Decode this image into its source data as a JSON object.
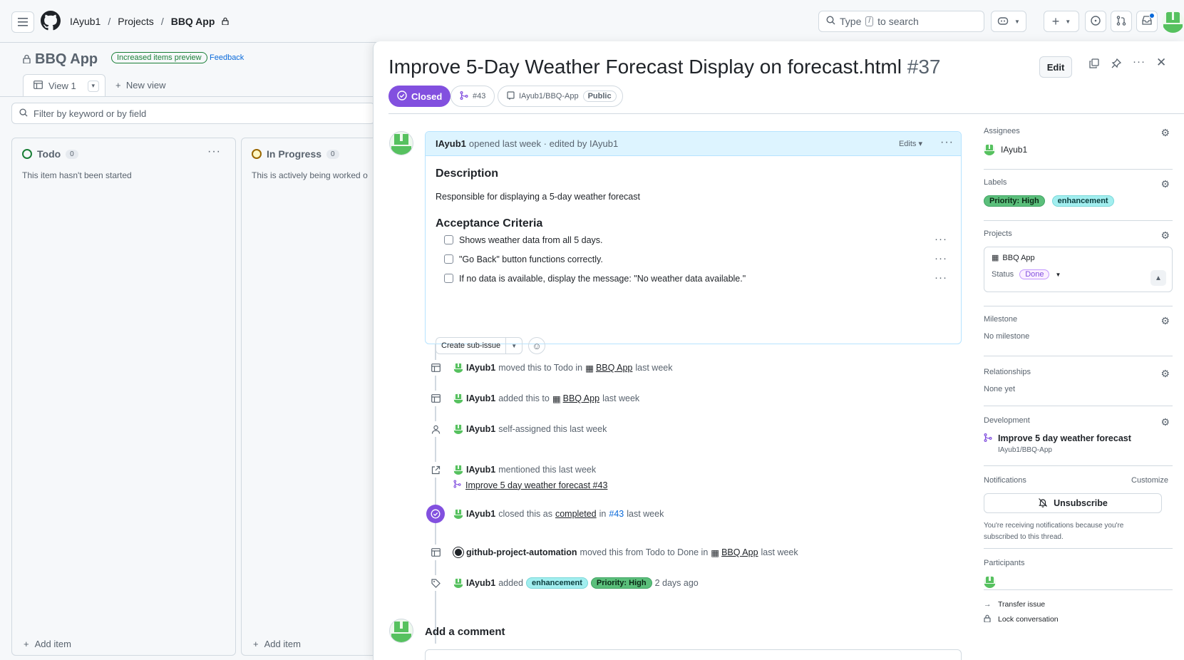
{
  "header": {
    "crumbs": [
      "IAyub1",
      "Projects",
      "BBQ App"
    ],
    "search_prefix": "Type",
    "search_key": "/",
    "search_suffix": "to search"
  },
  "board": {
    "title": "BBQ App",
    "preview_badge": "Increased items preview",
    "feedback": "Feedback",
    "view_tab": "View 1",
    "new_view": "New view",
    "filter_placeholder": "Filter by keyword or by field",
    "columns": [
      {
        "name": "Todo",
        "count": "0",
        "desc": "This item hasn't been started",
        "ring_color": "#1a7f37",
        "add": "Add item"
      },
      {
        "name": "In Progress",
        "count": "0",
        "desc": "This is actively being worked o",
        "ring_color": "#9a6700",
        "add": "Add item"
      }
    ]
  },
  "issue": {
    "title": "Improve 5-Day Weather Forecast Display on forecast.html",
    "number": "#37",
    "edit": "Edit",
    "state": "Closed",
    "pr": "#43",
    "repo": "IAyub1/BBQ-App",
    "visibility": "Public",
    "comment": {
      "author": "IAyub1",
      "meta": "opened last week · edited by IAyub1",
      "edits": "Edits",
      "h_description": "Description",
      "description": "Responsible for displaying a 5-day weather forecast",
      "h_acceptance": "Acceptance Criteria",
      "tasks": [
        "Shows weather data from all 5 days.",
        "\"Go Back\" button functions correctly.",
        "If no data is available, display the message: \"No weather data available.\""
      ],
      "create_sub_issue": "Create sub-issue"
    },
    "timeline": {
      "e1": {
        "actor": "IAyub1",
        "t1": "moved this to Todo in",
        "project": "BBQ App",
        "t2": "last week"
      },
      "e2": {
        "actor": "IAyub1",
        "t1": "added this to",
        "project": "BBQ App",
        "t2": "last week"
      },
      "e3": {
        "actor": "IAyub1",
        "t1": "self-assigned this last week"
      },
      "e4": {
        "actor": "IAyub1",
        "t1": "mentioned this last week",
        "link": "Improve 5 day weather forecast #43"
      },
      "e5": {
        "actor": "IAyub1",
        "t1": "closed this as",
        "completed": "completed",
        "t2": "in",
        "pr": "#43",
        "t3": "last week"
      },
      "e6": {
        "actor": "github-project-automation",
        "t1": "moved this from Todo to Done in",
        "project": "BBQ App",
        "t2": "last week"
      },
      "e7": {
        "actor": "IAyub1",
        "t1": "added",
        "label1": "enhancement",
        "label2": "Priority: High",
        "t2": "2 days ago"
      }
    },
    "add_comment": "Add a comment"
  },
  "sidebar": {
    "assignees_title": "Assignees",
    "assignee": "IAyub1",
    "labels_title": "Labels",
    "labels": [
      "Priority: High",
      "enhancement"
    ],
    "projects_title": "Projects",
    "project_name": "BBQ App",
    "status_label": "Status",
    "status_value": "Done",
    "milestone_title": "Milestone",
    "milestone_value": "No milestone",
    "relationships_title": "Relationships",
    "relationships_value": "None yet",
    "development_title": "Development",
    "dev_pr_title": "Improve 5 day weather forecast",
    "dev_pr_repo": "IAyub1/BBQ-App",
    "notifications_title": "Notifications",
    "customize": "Customize",
    "unsubscribe": "Unsubscribe",
    "notif_note": "You're receiving notifications because you're subscribed to this thread.",
    "participants_title": "Participants",
    "transfer": "Transfer issue",
    "lock": "Lock conversation"
  },
  "colors": {
    "closed": "#8250df",
    "accent": "#0969da",
    "avatar_green": "#56c15f"
  }
}
